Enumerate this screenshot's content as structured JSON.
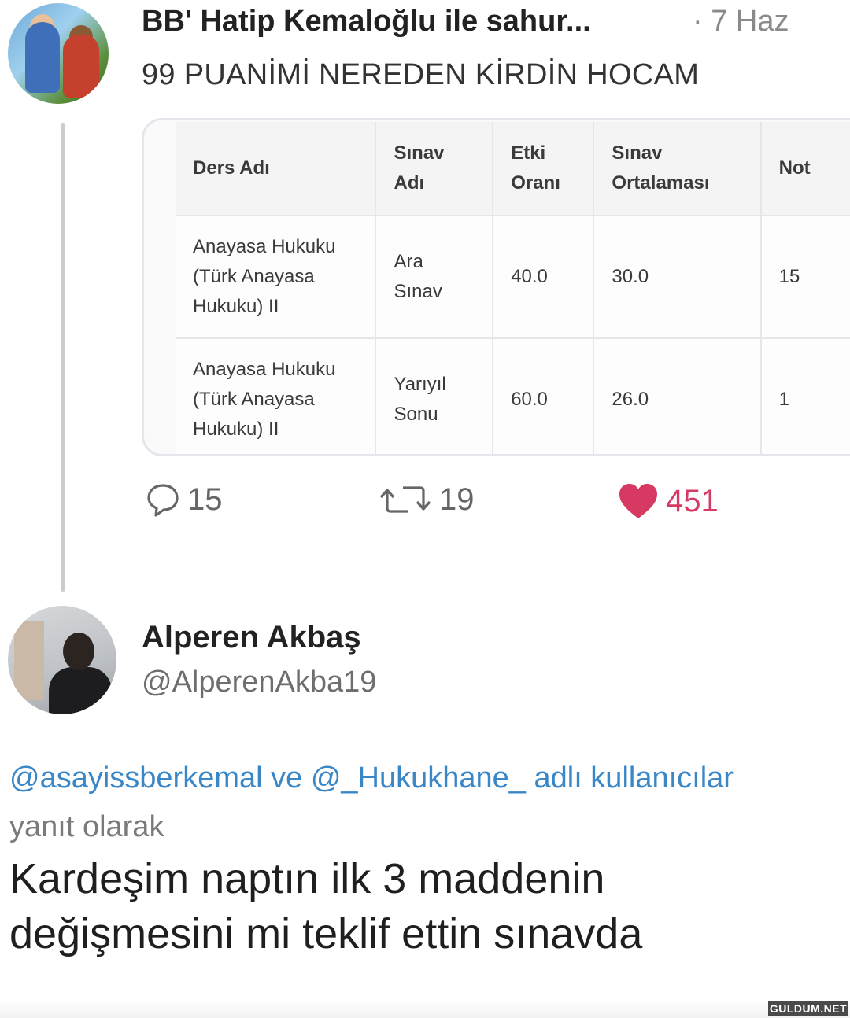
{
  "tweet": {
    "author": "BB' Hatip Kemaloğlu ile sahur...",
    "time": "· 7 Haz",
    "text": "99 PUANİMİ NEREDEN KİRDİN HOCAM",
    "table": {
      "headers": [
        [
          "Ders Adı"
        ],
        [
          "Sınav",
          "Adı"
        ],
        [
          "Etki",
          "Oranı"
        ],
        [
          "Sınav",
          "Ortalaması"
        ],
        [
          "Not"
        ]
      ],
      "rows": [
        [
          [
            "Anayasa Hukuku",
            "(Türk Anayasa",
            "Hukuku) II"
          ],
          [
            "Ara",
            "Sınav"
          ],
          [
            "40.0"
          ],
          [
            "30.0"
          ],
          [
            "15"
          ]
        ],
        [
          [
            "Anayasa Hukuku",
            "(Türk Anayasa",
            "Hukuku) II"
          ],
          [
            "Yarıyıl",
            "Sonu"
          ],
          [
            "60.0"
          ],
          [
            "26.0"
          ],
          [
            "1"
          ]
        ]
      ]
    },
    "stats": {
      "replies": "15",
      "retweets": "19",
      "likes": "451"
    },
    "colors": {
      "like": "#d63a63",
      "mention": "#3a87c8"
    },
    "icons": [
      "reply-icon",
      "retweet-icon",
      "heart-icon"
    ]
  },
  "reply": {
    "author": "Alperen Akbaş",
    "handle": "@AlperenAkba19",
    "mention1": "@asayissberkemal",
    "connector": " ve ",
    "mention2": "@_Hukukhane_",
    "suffix": " adlı kullanıcılar",
    "line2": "yanıt olarak",
    "text_line1": "Kardeşim naptın ilk 3 maddenin",
    "text_line2": "değişmesini mi teklif ettin sınavda"
  },
  "watermark": "GULDUM.NET"
}
